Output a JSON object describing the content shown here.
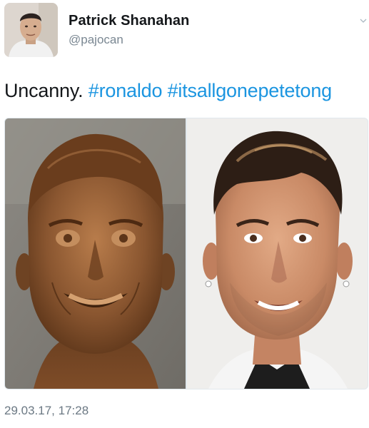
{
  "tweet": {
    "author": {
      "name": "Patrick Shanahan",
      "handle": "@pajocan",
      "avatar_icon": "user-photo"
    },
    "text": {
      "plain": "Uncanny.",
      "hashtags": [
        "#ronaldo",
        "#itsallgonepetetong"
      ]
    },
    "media": {
      "left_photo": "bronze-bust-photo",
      "right_photo": "portrait-photo"
    },
    "timestamp": "29.03.17, 17:28",
    "menu_icon": "chevron-down-icon"
  },
  "colors": {
    "text": "#14171a",
    "secondary": "#7a8792",
    "hashtag": "#1b95e0",
    "bronze": "#7a4e2c",
    "background": "#ffffff"
  }
}
